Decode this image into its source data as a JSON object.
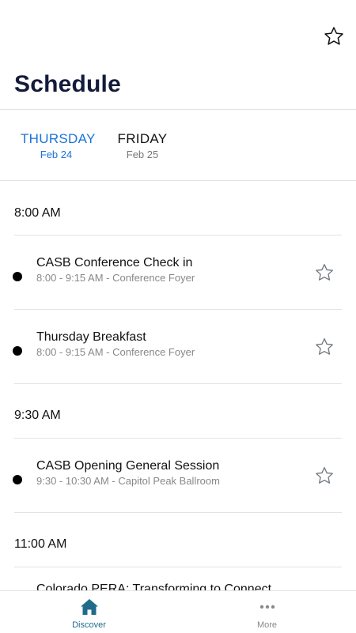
{
  "header": {
    "title": "Schedule",
    "favorite_icon": "star-outline-icon"
  },
  "day_tabs": [
    {
      "label": "THURSDAY",
      "date": "Feb 24",
      "selected": true
    },
    {
      "label": "FRIDAY",
      "date": "Feb 25",
      "selected": false
    }
  ],
  "schedule": {
    "groups": [
      {
        "time": "8:00 AM",
        "sessions": [
          {
            "title": "CASB Conference Check in",
            "details": "8:00 - 9:15 AM - Conference Foyer"
          },
          {
            "title": "Thursday Breakfast",
            "details": "8:00 - 9:15 AM - Conference Foyer"
          }
        ]
      },
      {
        "time": "9:30 AM",
        "sessions": [
          {
            "title": "CASB Opening General Session",
            "details": "9:30 - 10:30 AM - Capitol Peak Ballroom"
          }
        ]
      },
      {
        "time": "11:00 AM",
        "sessions": [
          {
            "title": "Colorado PERA: Transforming to Connect",
            "details": ""
          }
        ]
      }
    ]
  },
  "bottom_nav": [
    {
      "label": "Discover",
      "icon": "home-icon",
      "active": true
    },
    {
      "label": "More",
      "icon": "more-dots-icon",
      "active": false
    }
  ],
  "colors": {
    "accent_blue": "#1a73d9",
    "title_navy": "#141b3a",
    "nav_active": "#1f6b8c",
    "divider": "#e3e3e3"
  }
}
